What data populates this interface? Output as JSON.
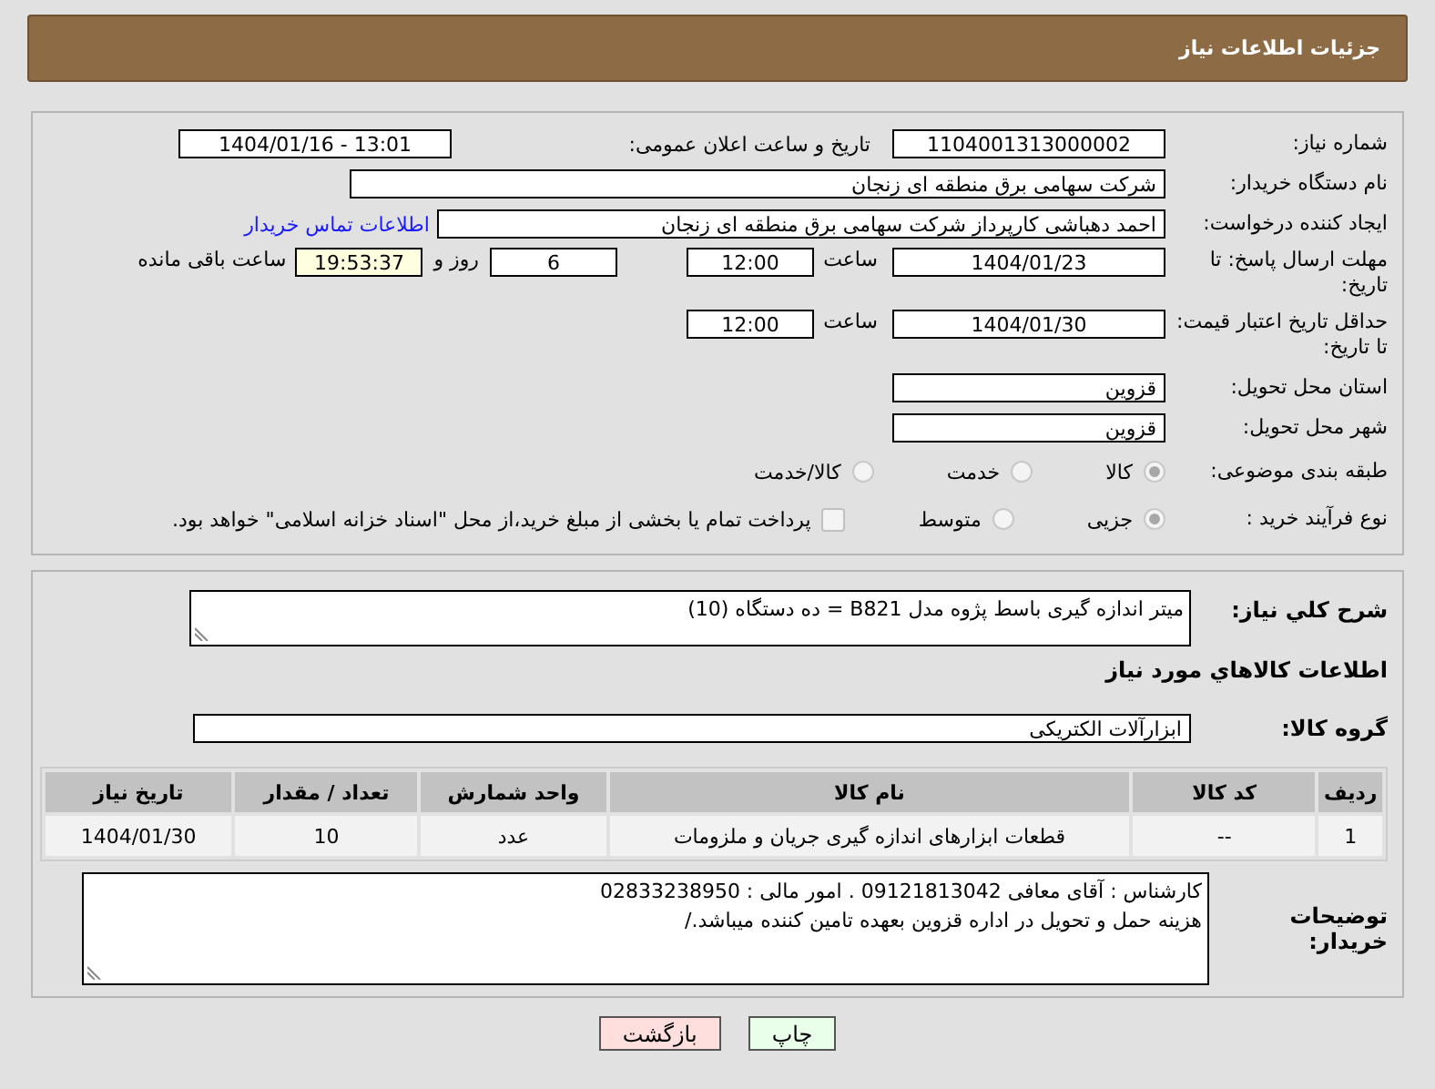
{
  "header": {
    "title": "جزئیات اطلاعات نیاز"
  },
  "need_number": {
    "label": "شماره نیاز:",
    "value": "1104001313000002"
  },
  "announce_datetime": {
    "label": "تاریخ و ساعت اعلان عمومی:",
    "value": "1404/01/16 - 13:01"
  },
  "buyer_org": {
    "label": "نام دستگاه خریدار:",
    "value": "شرکت سهامی برق منطقه ای زنجان"
  },
  "requester": {
    "label": "ایجاد کننده درخواست:",
    "value": "احمد دهباشی کارپرداز شرکت سهامی برق منطقه ای زنجان",
    "link": "اطلاعات تماس خریدار"
  },
  "reply_deadline": {
    "label": "مهلت ارسال پاسخ: تا تاریخ:",
    "date": "1404/01/23",
    "time_label": "ساعت",
    "time": "12:00",
    "days": "6",
    "days_label": "روز و",
    "remaining": "19:53:37",
    "remaining_label": "ساعت باقی مانده"
  },
  "price_validity": {
    "label": "حداقل تاریخ اعتبار قیمت: تا تاریخ:",
    "date": "1404/01/30",
    "time_label": "ساعت",
    "time": "12:00"
  },
  "delivery_province": {
    "label": "استان محل تحویل:",
    "value": "قزوین"
  },
  "delivery_city": {
    "label": "شهر محل تحویل:",
    "value": "قزوین"
  },
  "category": {
    "label": "طبقه بندی موضوعی:",
    "options": [
      {
        "label": "کالا",
        "selected": true
      },
      {
        "label": "خدمت",
        "selected": false
      },
      {
        "label": "کالا/خدمت",
        "selected": false
      }
    ]
  },
  "purchase_process": {
    "label": "نوع فرآیند خرید :",
    "options": [
      {
        "label": "جزیی",
        "selected": true
      },
      {
        "label": "متوسط",
        "selected": false
      }
    ],
    "treasury": {
      "label": "پرداخت تمام یا بخشی از مبلغ خرید،از محل \"اسناد خزانه اسلامی\" خواهد بود.",
      "checked": false
    }
  },
  "description": {
    "label": "شرح کلي نياز:",
    "value": "میتر اندازه گیری باسط پژوه مدل B821  = ده دستگاه (10)"
  },
  "goods_heading": "اطلاعات کالاهاي مورد نياز",
  "goods_group": {
    "label": "گروه کالا:",
    "value": "ابزارآلات الکتریکی"
  },
  "table": {
    "columns": [
      "ردیف",
      "کد کالا",
      "نام کالا",
      "واحد شمارش",
      "تعداد / مقدار",
      "تاریخ نیاز"
    ],
    "rows": [
      [
        "1",
        "--",
        "قطعات ابزارهای اندازه گیری جریان و ملزومات",
        "عدد",
        "10",
        "1404/01/30"
      ]
    ]
  },
  "buyer_notes": {
    "label": "توضیحات خریدار:",
    "lines": [
      "کارشناس : آقای معافی 09121813042 . امور مالی : 02833238950",
      "هزینه حمل و تحویل در اداره قزوین بعهده تامین کننده میباشد./"
    ]
  },
  "buttons": [
    {
      "label": "چاپ",
      "kind": "print"
    },
    {
      "label": "بازگشت",
      "kind": "back"
    }
  ]
}
